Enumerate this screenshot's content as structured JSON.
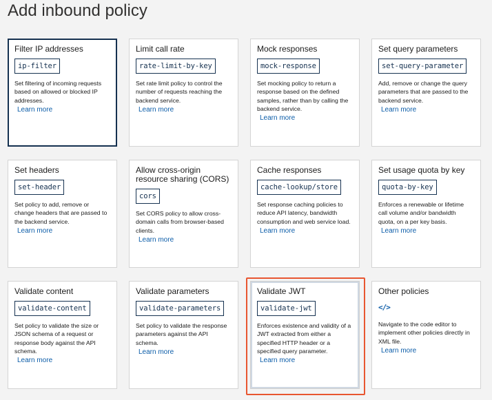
{
  "page": {
    "title": "Add inbound policy"
  },
  "common": {
    "learn_more": "Learn more"
  },
  "policies": [
    {
      "title": "Filter IP addresses",
      "code": "ip-filter",
      "description": "Set filtering of incoming requests based on allowed or blocked IP addresses.",
      "state": "selected"
    },
    {
      "title": "Limit call rate",
      "code": "rate-limit-by-key",
      "description": "Set rate limit policy to control the number of requests reaching the backend service."
    },
    {
      "title": "Mock responses",
      "code": "mock-response",
      "description": "Set mocking policy to return a response based on the defined samples, rather than by calling the backend service."
    },
    {
      "title": "Set query parameters",
      "code": "set-query-parameter",
      "description": "Add, remove or change the query parameters that are passed to the backend service."
    },
    {
      "title": "Set headers",
      "code": "set-header",
      "description": "Set policy to add, remove or change headers that are passed to the backend service."
    },
    {
      "title": "Allow cross-origin resource sharing (CORS)",
      "code": "cors",
      "description": "Set CORS policy to allow cross-domain calls from browser-based clients."
    },
    {
      "title": "Cache responses",
      "code": "cache-lookup/store",
      "description": "Set response caching policies to reduce API latency, bandwidth consumption and web service load."
    },
    {
      "title": "Set usage quota by key",
      "code": "quota-by-key",
      "description": "Enforces a renewable or lifetime call volume and/or bandwidth quota, on a per key basis."
    },
    {
      "title": "Validate content",
      "code": "validate-content",
      "description": "Set policy to validate the size or JSON schema of a request or response body against the API schema."
    },
    {
      "title": "Validate parameters",
      "code": "validate-parameters",
      "description": "Set policy to validate the response parameters against the API schema."
    },
    {
      "title": "Validate JWT",
      "code": "validate-jwt",
      "description": "Enforces existence and validity of a JWT extracted from either a specified HTTP header or a specified query parameter.",
      "state": "highlighted"
    },
    {
      "title": "Other policies",
      "icon": "code-brackets-icon",
      "icon_glyph": "</>",
      "description": "Navigate to the code editor to implement other policies directly in XML file."
    }
  ],
  "colors": {
    "accent": "#0b5ca8",
    "chip": "#14304f",
    "highlight": "#e8552f",
    "background": "#f3f3f3"
  }
}
